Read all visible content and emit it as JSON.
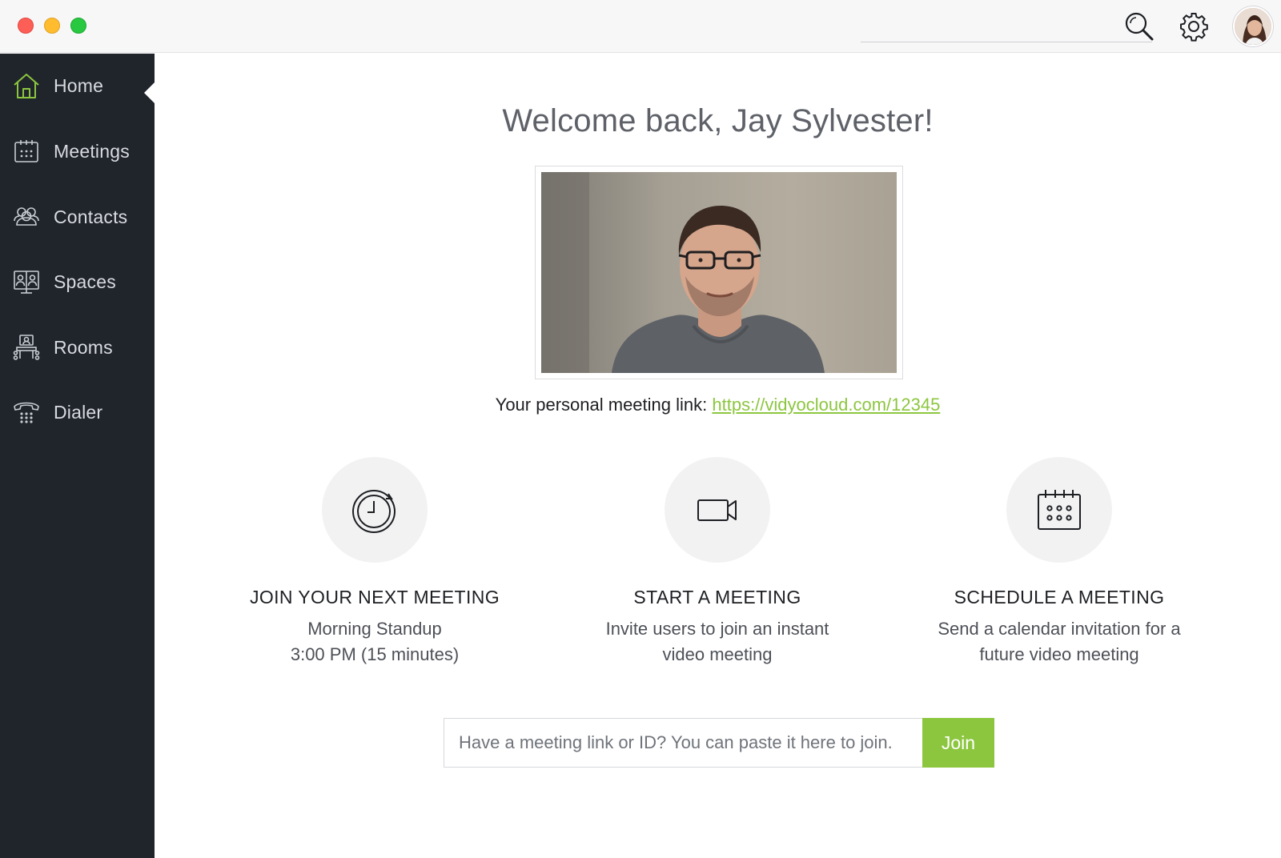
{
  "window": {
    "controls": [
      "close",
      "minimize",
      "zoom"
    ]
  },
  "header": {
    "icons": [
      "search-icon",
      "gear-icon",
      "avatar"
    ]
  },
  "sidebar": {
    "items": [
      {
        "label": "Home",
        "icon": "home-icon",
        "active": true
      },
      {
        "label": "Meetings",
        "icon": "calendar-icon",
        "active": false
      },
      {
        "label": "Contacts",
        "icon": "contacts-icon",
        "active": false
      },
      {
        "label": "Spaces",
        "icon": "spaces-icon",
        "active": false
      },
      {
        "label": "Rooms",
        "icon": "rooms-icon",
        "active": false
      },
      {
        "label": "Dialer",
        "icon": "phone-icon",
        "active": false
      }
    ]
  },
  "main": {
    "welcome": "Welcome back, Jay Sylvester!",
    "link_prefix": "Your personal meeting link:",
    "link_url": "https://vidyocloud.com/12345",
    "actions": [
      {
        "title": "JOIN YOUR NEXT MEETING",
        "line1": "Morning Standup",
        "line2": "3:00 PM (15 minutes)",
        "icon": "clock-icon"
      },
      {
        "title": "START A MEETING",
        "line1": "Invite users to join an instant",
        "line2": "video meeting",
        "icon": "video-camera-icon"
      },
      {
        "title": "SCHEDULE A MEETING",
        "line1": "Send a calendar invitation for a",
        "line2": "future video meeting",
        "icon": "calendar-icon"
      }
    ],
    "join": {
      "placeholder": "Have a meeting link or ID? You can paste it here to join.",
      "button_label": "Join"
    }
  },
  "colors": {
    "accent": "#8cc63f",
    "sidebar_bg": "#20242b",
    "text_muted": "#5e6168"
  }
}
